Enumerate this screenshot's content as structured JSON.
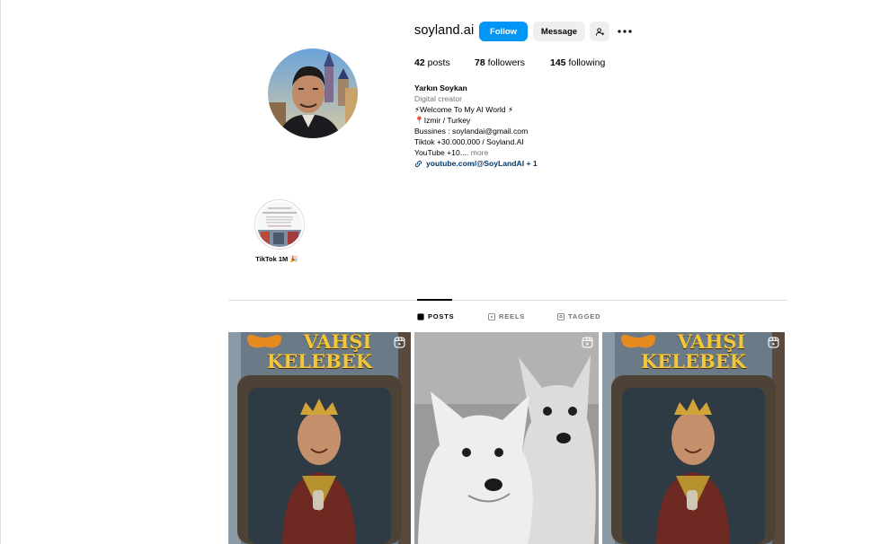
{
  "profile": {
    "username": "soyland.ai",
    "follow_label": "Follow",
    "message_label": "Message",
    "stats": {
      "posts_count": "42",
      "posts_label": "posts",
      "followers_count": "78",
      "followers_label": "followers",
      "following_count": "145",
      "following_label": "following"
    },
    "bio": {
      "name": "Yarkın Soykan",
      "category": "Digital creator",
      "line1": "⚡Welcome To My AI World ⚡",
      "line2": "📍Izmir / Turkey",
      "line3": "Bussines : soylandai@gmail.com",
      "line4": "Tiktok +30.000.000 / Soyland.AI",
      "line5": "YouTube +10....",
      "more": "more",
      "link": "youtube.com/@SoyLandAI + 1"
    }
  },
  "highlights": [
    {
      "label": "TikTok 1M 🎉"
    }
  ],
  "tabs": [
    {
      "label": "POSTS",
      "active": true
    },
    {
      "label": "REELS",
      "active": false
    },
    {
      "label": "TAGGED",
      "active": false
    }
  ],
  "posts": [
    {
      "title_line1": "VAHŞİ",
      "title_line2": "KELEBEK",
      "type": "reel",
      "subject": "king-portrait"
    },
    {
      "type": "reel",
      "subject": "white-wolf-pups"
    },
    {
      "title_line1": "VAHŞİ",
      "title_line2": "KELEBEK",
      "type": "reel",
      "subject": "king-portrait"
    }
  ],
  "icons": {
    "suggest": "add-person-icon",
    "more": "more-options-icon",
    "link": "link-icon",
    "reel_badge": "reel-icon"
  },
  "colors": {
    "accent": "#0095f6",
    "link": "#00376b",
    "muted": "#737373",
    "border": "#dbdbdb"
  }
}
